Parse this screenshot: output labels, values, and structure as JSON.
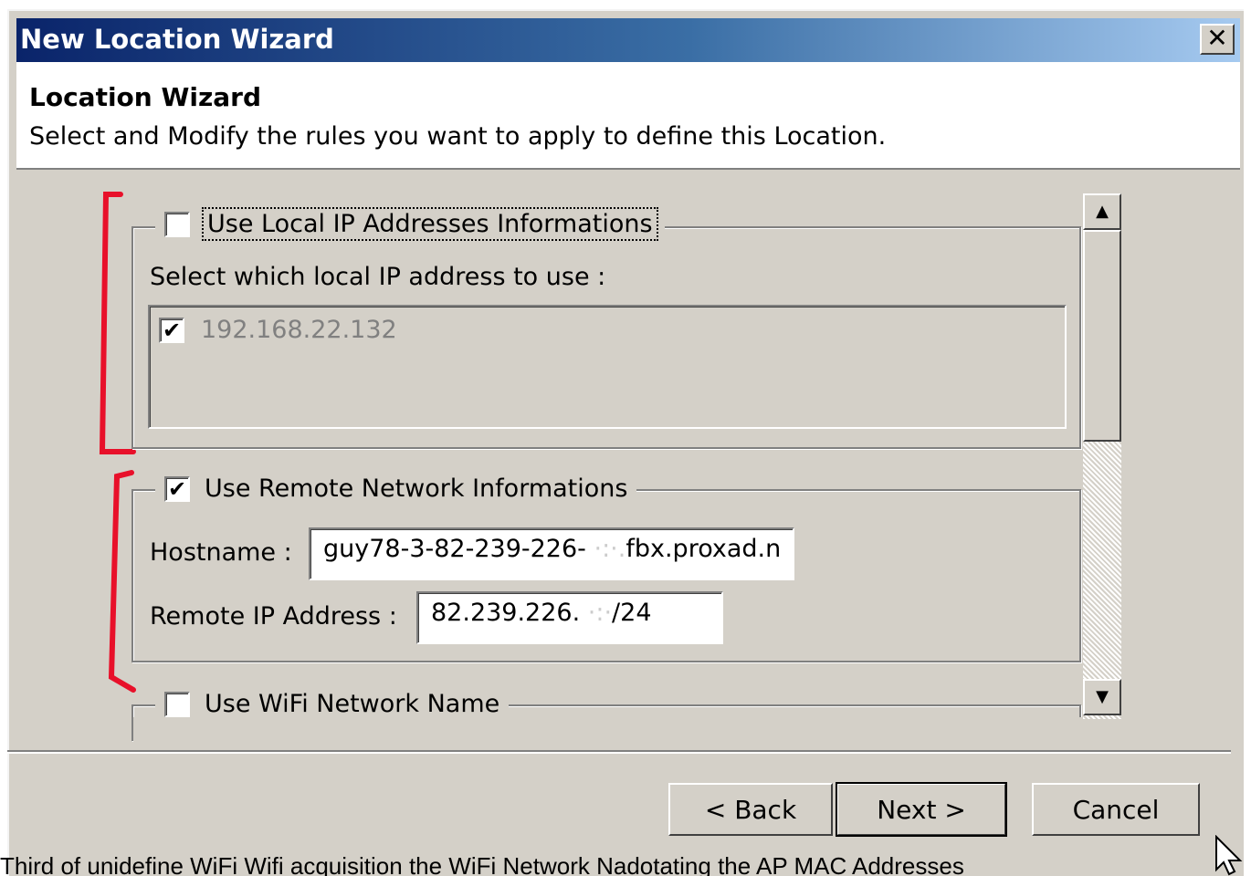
{
  "window": {
    "title": "New Location Wizard",
    "close_glyph": "✕"
  },
  "header": {
    "title": "Location Wizard",
    "subtitle": "Select and Modify the rules you want to apply to define this Location."
  },
  "groups": {
    "local_ip": {
      "label": "Use Local IP Addresses Informations",
      "checked": false,
      "select_label": "Select which local IP address to use :",
      "addresses": [
        {
          "address": "192.168.22.132",
          "checked": true
        }
      ]
    },
    "remote_network": {
      "label": "Use Remote Network Informations",
      "checked": true,
      "hostname_label": "Hostname :",
      "hostname_value": "guy78-3-82-239-226-",
      "hostname_value_tail": "fbx.proxad.n",
      "remote_ip_label": "Remote IP Address :",
      "remote_ip_value": "82.239.226.",
      "remote_ip_value_tail": "/24"
    },
    "wifi": {
      "label": "Use WiFi Network Name",
      "checked": false
    }
  },
  "scrollbar": {
    "up_icon": "scroll-up-arrow",
    "down_icon": "scroll-down-arrow"
  },
  "buttons": {
    "back": "< Back",
    "next": "Next >",
    "cancel": "Cancel"
  },
  "caption": "Third of unidefine WiFi Wifi acquisition the WiFi Network Nadotating the AP MAC Addresses"
}
